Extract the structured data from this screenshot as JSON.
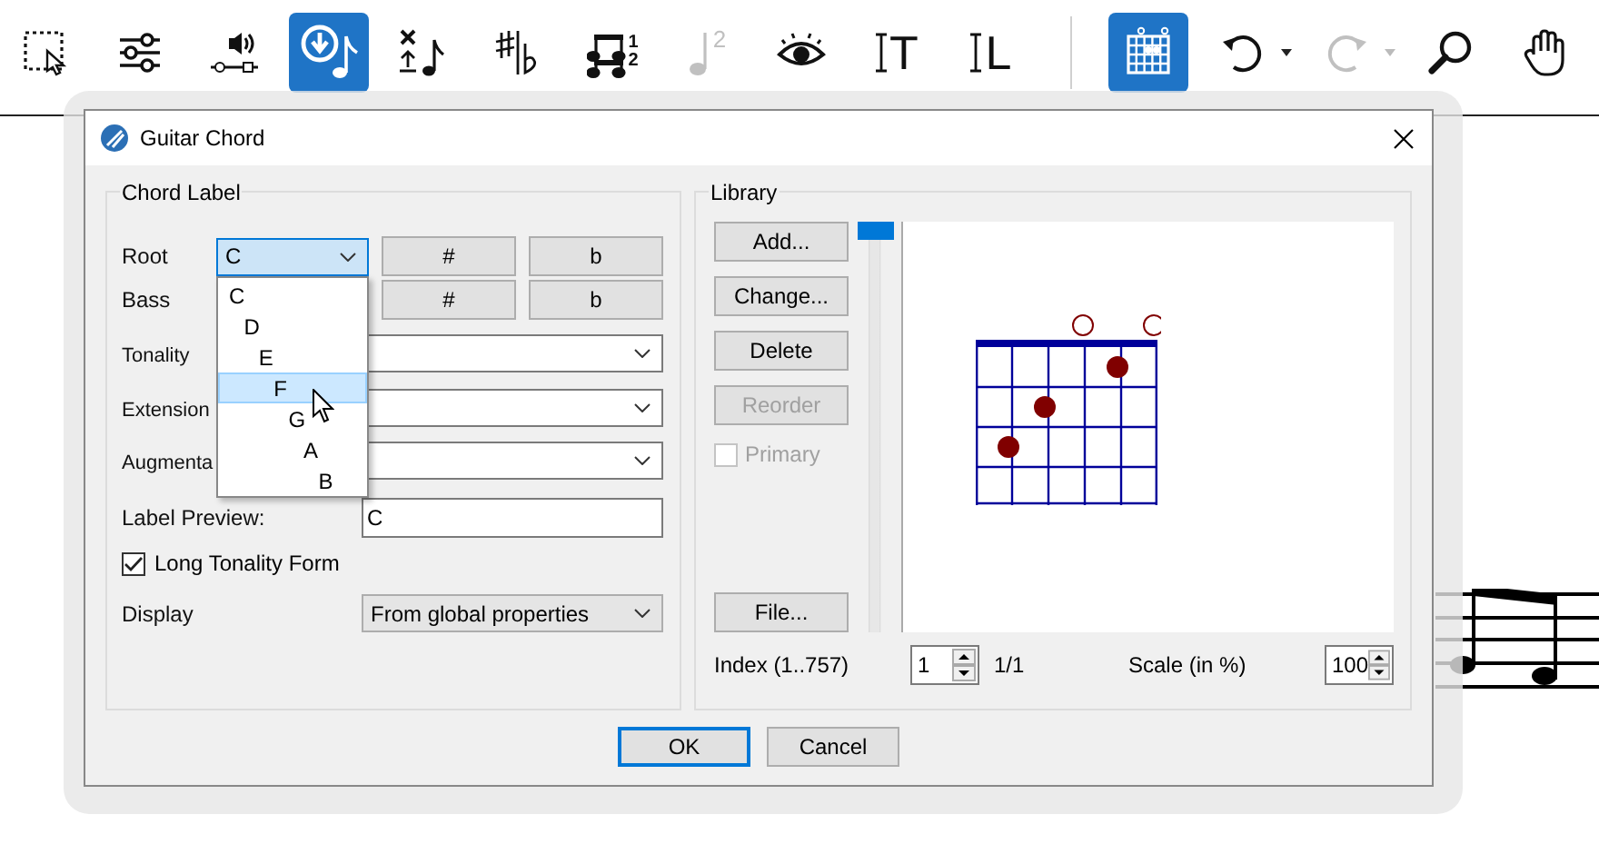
{
  "toolbar": {
    "tools": [
      {
        "kind": "select",
        "selected": false,
        "disabled": false
      },
      {
        "kind": "mixer",
        "selected": false,
        "disabled": false
      },
      {
        "kind": "sound",
        "selected": false,
        "disabled": false
      },
      {
        "kind": "note-input",
        "selected": true,
        "disabled": false
      },
      {
        "kind": "note-props",
        "selected": false,
        "disabled": false
      },
      {
        "kind": "accidentals",
        "selected": false,
        "disabled": false
      },
      {
        "kind": "voices",
        "selected": false,
        "disabled": false,
        "digits": [
          "1",
          "2"
        ]
      },
      {
        "kind": "interval",
        "selected": false,
        "disabled": true,
        "digits": [
          "2"
        ]
      },
      {
        "kind": "view",
        "selected": false,
        "disabled": false
      },
      {
        "kind": "text",
        "selected": false,
        "disabled": false,
        "glyph": "T"
      },
      {
        "kind": "text",
        "selected": false,
        "disabled": false,
        "glyph": "L"
      },
      {
        "kind": "divider"
      },
      {
        "kind": "chord-grid",
        "selected": true,
        "disabled": false
      },
      {
        "kind": "undo",
        "selected": false,
        "disabled": false
      },
      {
        "kind": "redo",
        "selected": false,
        "disabled": true
      },
      {
        "kind": "zoom",
        "selected": false,
        "disabled": false
      },
      {
        "kind": "hand",
        "selected": false,
        "disabled": false
      }
    ]
  },
  "dialog": {
    "title": "Guitar Chord",
    "chord_label": {
      "title": "Chord Label",
      "root": {
        "label": "Root",
        "value": "C",
        "sharp": "#",
        "flat": "b"
      },
      "bass": {
        "label": "Bass",
        "sharp": "#",
        "flat": "b"
      },
      "combos": [
        {
          "label": "Tonality"
        },
        {
          "label": "Extension"
        },
        {
          "label": "Augmenta"
        }
      ],
      "preview": {
        "label": "Label Preview:",
        "value": "C"
      },
      "long_tonality": {
        "label": "Long Tonality Form",
        "checked": true
      },
      "display": {
        "label": "Display",
        "value": "From global properties"
      },
      "dropdown": [
        {
          "label": "C",
          "selected": false
        },
        {
          "label": "D",
          "selected": false
        },
        {
          "label": "E",
          "selected": false
        },
        {
          "label": "F",
          "selected": true
        },
        {
          "label": "G",
          "selected": false
        },
        {
          "label": "A",
          "selected": false
        },
        {
          "label": "B",
          "selected": false
        }
      ]
    },
    "library": {
      "title": "Library",
      "buttons": [
        {
          "label": "Add...",
          "disabled": false
        },
        {
          "label": "Change...",
          "disabled": false
        },
        {
          "label": "Delete",
          "disabled": false
        },
        {
          "label": "Reorder",
          "disabled": true
        }
      ],
      "primary": {
        "label": "Primary",
        "checked": false,
        "disabled": true
      },
      "file_button": "File...",
      "slider": {
        "level": 0
      },
      "index": {
        "label": "Index (1..757)",
        "value": "1",
        "count": "1/1"
      },
      "scale": {
        "label": "Scale (in %)",
        "value": "100"
      }
    },
    "buttons": [
      {
        "label": "OK",
        "default": true
      },
      {
        "label": "Cancel",
        "default": false
      }
    ]
  }
}
